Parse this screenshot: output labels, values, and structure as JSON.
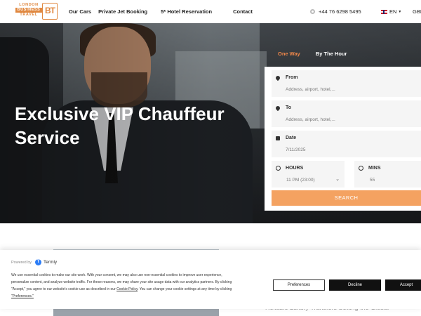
{
  "header": {
    "logo": {
      "line1": "LONDON",
      "line2": "BUSINESS",
      "line3": "TRAVEL",
      "mark": "BT"
    },
    "nav": [
      "Our Cars",
      "Private Jet Booking",
      "5* Hotel Reservation",
      "Contact"
    ],
    "phone": "+44 76 6298 5495",
    "language": "EN",
    "currency": "GBP"
  },
  "hero": {
    "title": "Exclusive VIP Chauffeur Service"
  },
  "booking": {
    "tabs": [
      "One Way",
      "By The Hour"
    ],
    "active_tab": "One Way",
    "from": {
      "label": "From",
      "placeholder": "Address, airport, hotel,..."
    },
    "to": {
      "label": "To",
      "placeholder": "Address, airport, hotel,..."
    },
    "date": {
      "label": "Date",
      "value": "7/11/2025"
    },
    "hours": {
      "label": "HOURS",
      "value": "11 PM (23:00)"
    },
    "mins": {
      "label": "MINS",
      "value": "55"
    },
    "search_label": "SEARCH"
  },
  "below": {
    "tagline": "Reliable Luxury Transfers Setting the Global"
  },
  "cookie_banner": {
    "powered_by": "Powered by",
    "brand": "Termly",
    "text_1": "We use essential cookies to make our site work. With your consent, we may also use non-essential cookies to improve user experience,",
    "text_2": "personalize content, and analyze website traffic. For these reasons, we may share your site usage data with our analytics partners. By clicking",
    "text_3": "\"Accept,\" you agree to our website's cookie use as described in our",
    "cookie_policy_link": "Cookie Policy",
    "text_4": ". You can change your cookie settings at any time by clicking",
    "preferences_link": "\"Preferences.\"",
    "preferences_button": "Preferences",
    "decline_button": "Decline",
    "accept_button": "Accept"
  },
  "colors": {
    "accent": "#f4a261",
    "accent_text": "#f0884a",
    "logo": "#e08840",
    "dark_button": "#111111"
  }
}
